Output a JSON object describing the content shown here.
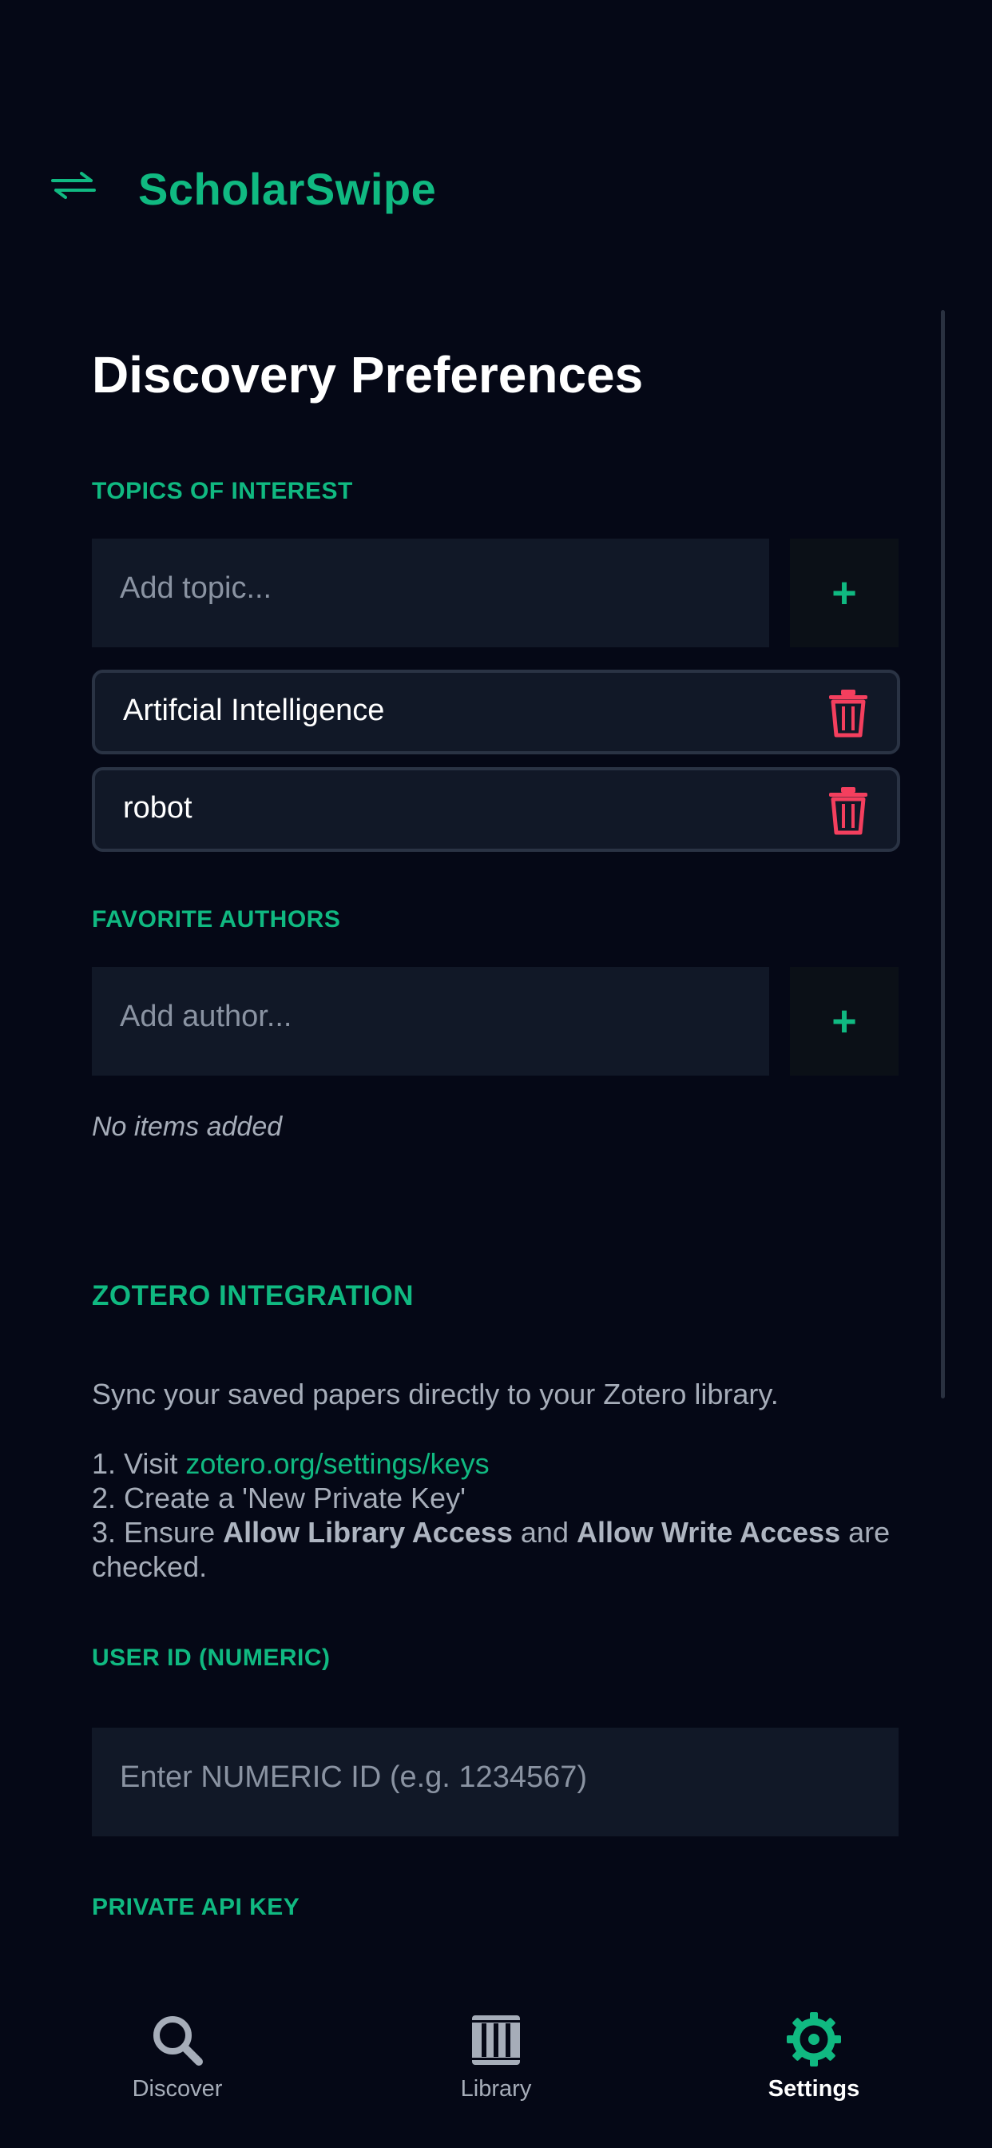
{
  "app": {
    "title": "ScholarSwipe",
    "colors": {
      "accent": "#10b981",
      "background": "#050816",
      "surface": "#111827",
      "danger": "#f43f5e"
    }
  },
  "preferences": {
    "heading": "Discovery Preferences",
    "topics": {
      "label": "TOPICS OF INTEREST",
      "input_placeholder": "Add topic...",
      "add_label": "+",
      "items": [
        {
          "label": "Artifcial Intelligence"
        },
        {
          "label": "robot"
        }
      ]
    },
    "authors": {
      "label": "FAVORITE AUTHORS",
      "input_placeholder": "Add author...",
      "add_label": "+",
      "empty_text": "No items added"
    }
  },
  "zotero": {
    "label": "ZOTERO INTEGRATION",
    "description": "Sync your saved papers directly to your Zotero library.",
    "steps": {
      "step1_prefix": "1. Visit ",
      "step1_link": "zotero.org/settings/keys",
      "step2": "2. Create a 'New Private Key'",
      "step3_prefix": "3. Ensure ",
      "step3_bold1": "Allow Library Access",
      "step3_mid": " and ",
      "step3_bold2": "Allow Write Access",
      "step3_suffix": " are checked."
    },
    "user_id": {
      "label": "USER ID (NUMERIC)",
      "placeholder": "Enter NUMERIC ID (e.g. 1234567)"
    },
    "api_key": {
      "label": "PRIVATE API KEY"
    }
  },
  "nav": {
    "items": [
      {
        "label": "Discover",
        "icon": "search-icon",
        "active": false
      },
      {
        "label": "Library",
        "icon": "library-icon",
        "active": false
      },
      {
        "label": "Settings",
        "icon": "gear-icon",
        "active": true
      }
    ]
  }
}
